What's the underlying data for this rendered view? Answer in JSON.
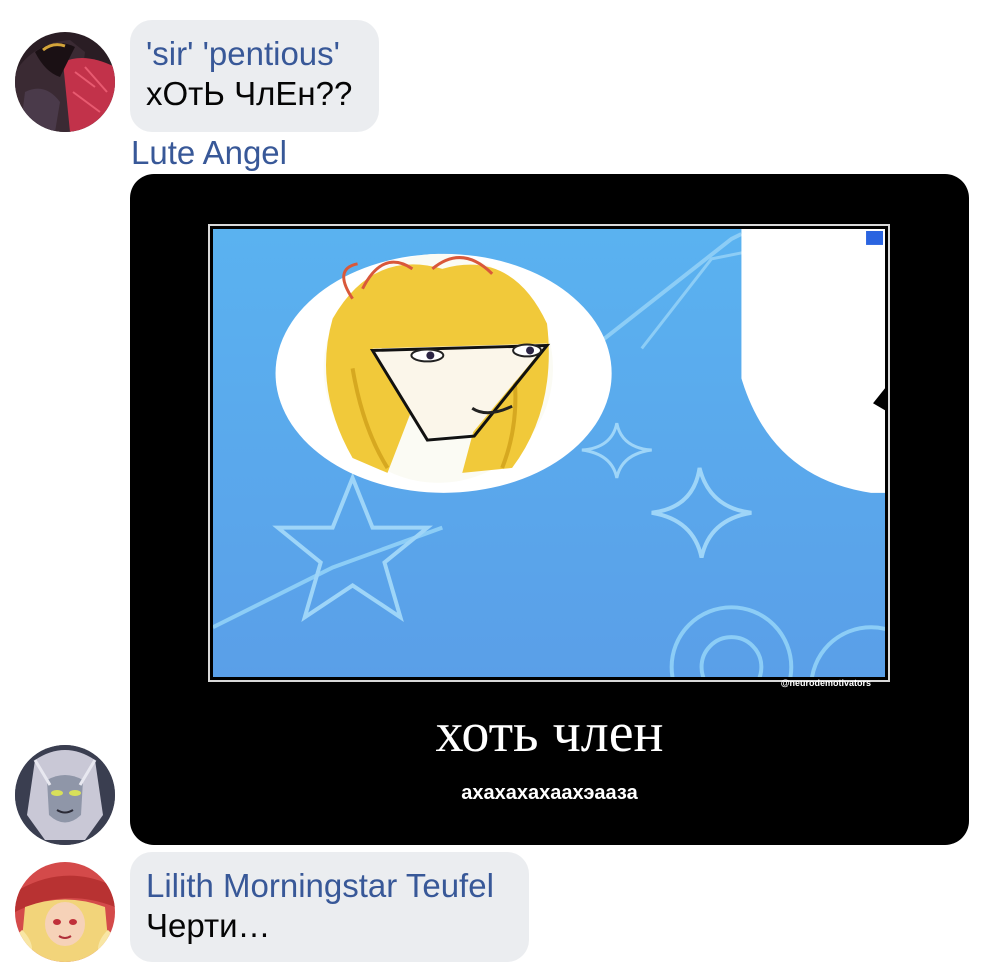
{
  "messages": [
    {
      "sender": "'sir' 'pentious'",
      "text": "хОтЬ ЧлЕн??",
      "avatar_icon": "sir-pentious-avatar"
    },
    {
      "sender": "Lute Angel",
      "avatar_icon": "lute-angel-avatar",
      "image": {
        "title": "хоть член",
        "subtitle": "ахахахахаахэааза",
        "watermark": "@neurodemotivators",
        "background": "#000000",
        "picture_icon": "blonde-character-sticker-image"
      }
    },
    {
      "sender": "Lilith Morningstar Teufel",
      "text": "Черти…",
      "avatar_icon": "lilith-avatar"
    }
  ],
  "colors": {
    "sender_name": "#385898",
    "bubble_bg": "#ebedf0",
    "message_text": "#050505"
  }
}
